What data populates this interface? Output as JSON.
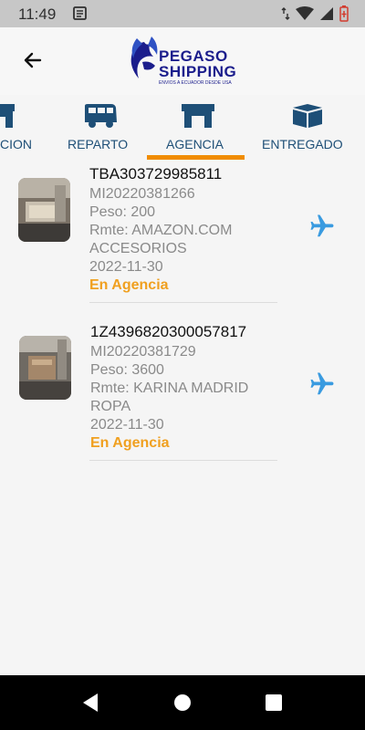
{
  "status_bar": {
    "time": "11:49"
  },
  "header": {
    "logo_line1": "PEGASO",
    "logo_line2": "SHIPPING",
    "logo_tagline": "ENVIOS A ECUADOR DESDE USA",
    "brand_color": "#1b1d8c"
  },
  "tabs": [
    {
      "label": "CION",
      "icon": "store-icon"
    },
    {
      "label": "REPARTO",
      "icon": "van-icon"
    },
    {
      "label": "AGENCIA",
      "icon": "store-icon"
    },
    {
      "label": "ENTREGADO",
      "icon": "box-icon"
    }
  ],
  "active_tab_color": "#f08c00",
  "packages": [
    {
      "tracking": "TBA303729985811",
      "code": "MI20220381266",
      "weight": "Peso: 200",
      "sender": "Rmte: AMAZON.COM",
      "description": "ACCESORIOS",
      "date": "2022-11-30",
      "status": "En Agencia",
      "icon": "airplane-icon"
    },
    {
      "tracking": "1Z4396820300057817",
      "code": "MI20220381729",
      "weight": "Peso: 3600",
      "sender": "Rmte: KARINA MADRID",
      "description": "ROPA",
      "date": "2022-11-30",
      "status": "En Agencia",
      "icon": "airplane-icon"
    }
  ],
  "colors": {
    "status": "#f0a020",
    "plane": "#3a9be0",
    "tab_text": "#1e4f77"
  }
}
